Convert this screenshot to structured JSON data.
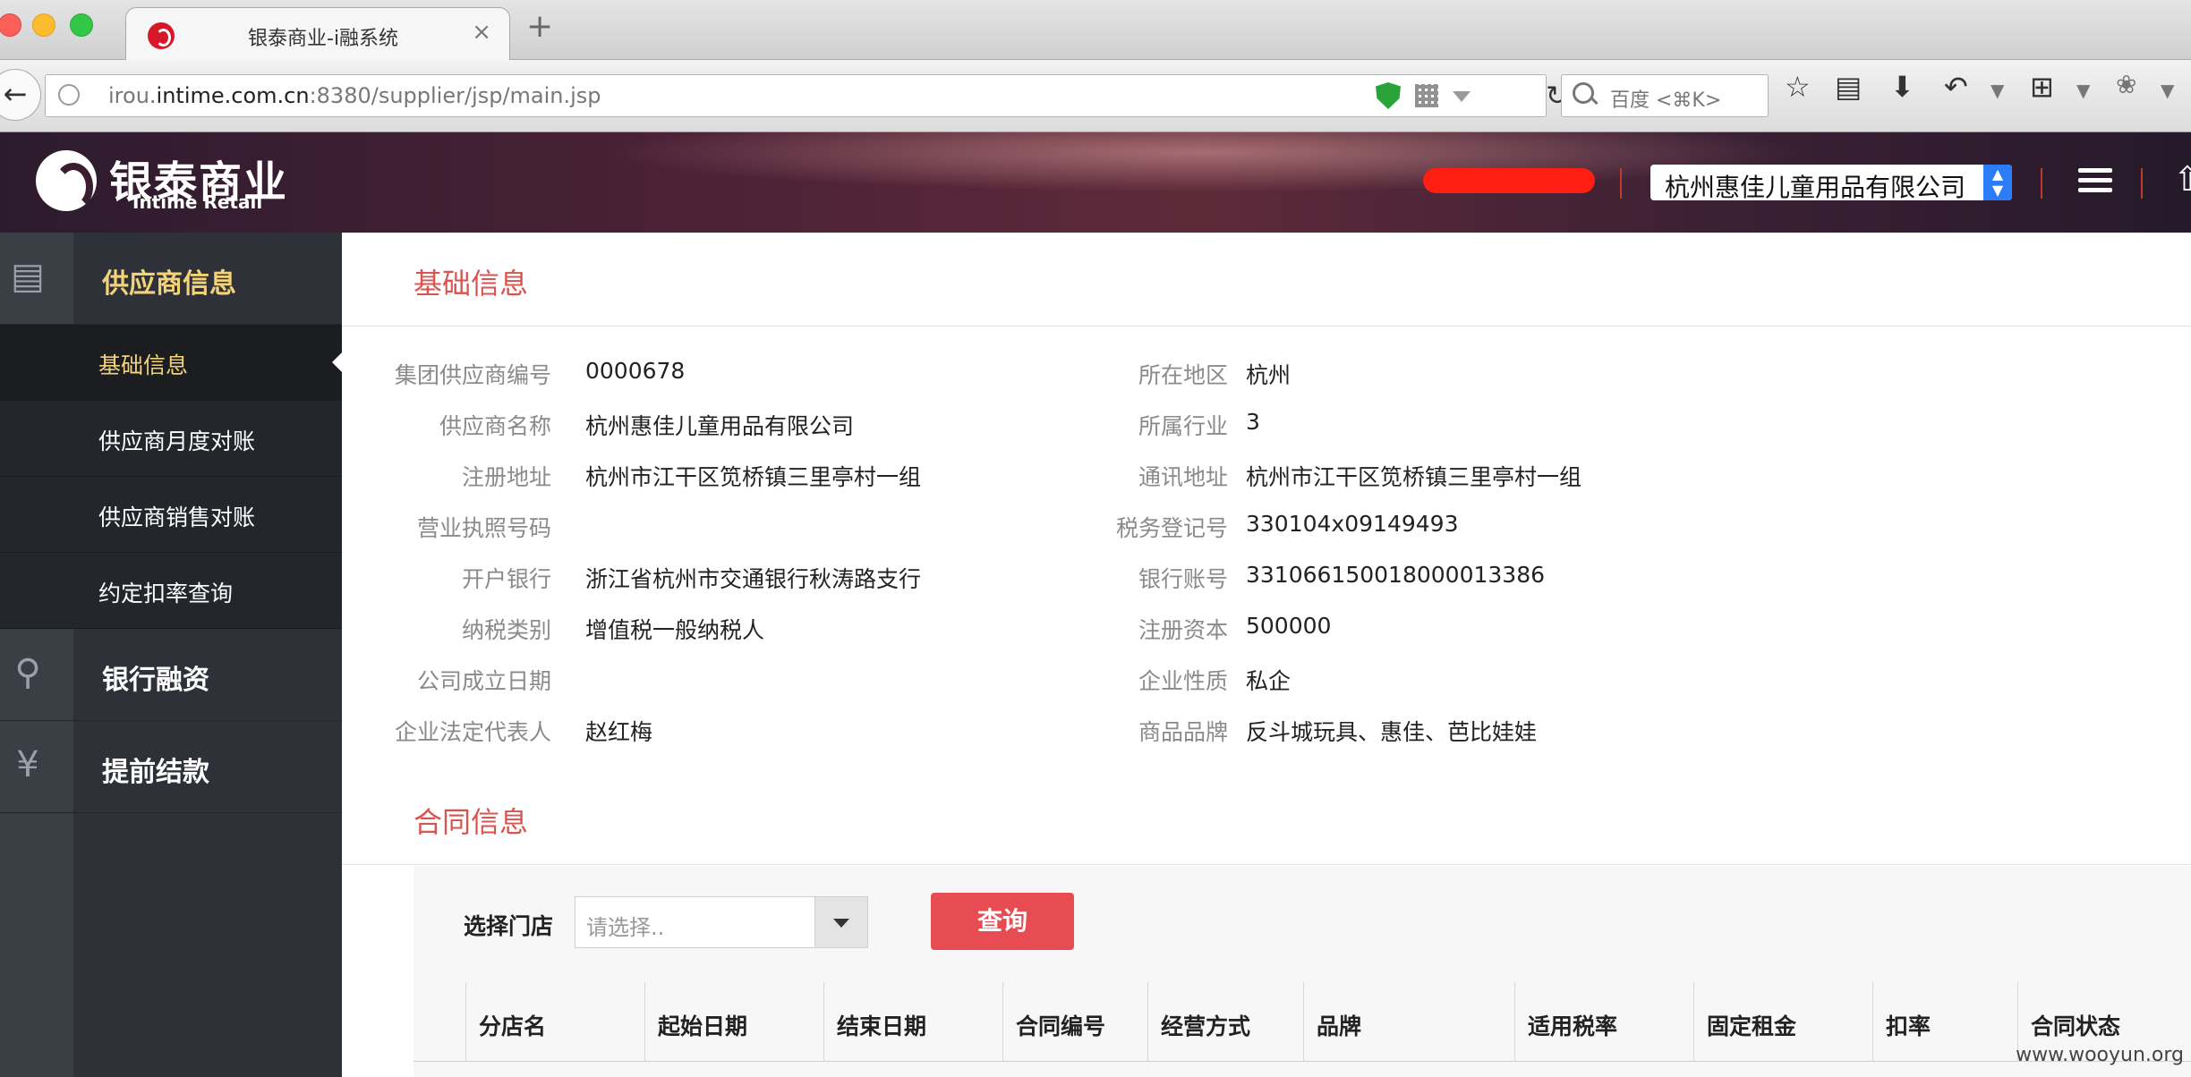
{
  "browser": {
    "tab_title": "银泰商业-i融系统",
    "tab_close": "×",
    "new_tab": "+",
    "url_prefix": "irou.",
    "url_domain": "intime.com.cn",
    "url_path": ":8380/supplier/jsp/main.jsp",
    "search_placeholder": "百度 <⌘K>"
  },
  "header": {
    "logo_cn": "银泰商业",
    "logo_en": "Intime Retail",
    "company": "杭州惠佳儿童用品有限公司"
  },
  "sidebar": {
    "groups": [
      {
        "label": "供应商信息",
        "icon": "list-icon"
      },
      {
        "label": "银行融资",
        "icon": "bag-search-icon"
      },
      {
        "label": "提前结款",
        "icon": "yen-icon"
      }
    ],
    "sub_items": [
      {
        "label": "基础信息"
      },
      {
        "label": "供应商月度对账"
      },
      {
        "label": "供应商销售对账"
      },
      {
        "label": "约定扣率查询"
      }
    ]
  },
  "basic_info": {
    "title": "基础信息",
    "left": [
      {
        "label": "集团供应商编号",
        "value": "0000678"
      },
      {
        "label": "供应商名称",
        "value": "杭州惠佳儿童用品有限公司"
      },
      {
        "label": "注册地址",
        "value": "杭州市江干区笕桥镇三里亭村一组"
      },
      {
        "label": "营业执照号码",
        "value": ""
      },
      {
        "label": "开户银行",
        "value": "浙江省杭州市交通银行秋涛路支行"
      },
      {
        "label": "纳税类别",
        "value": "增值税一般纳税人"
      },
      {
        "label": "公司成立日期",
        "value": ""
      },
      {
        "label": "企业法定代表人",
        "value": "赵红梅"
      }
    ],
    "right": [
      {
        "label": "所在地区",
        "value": "杭州"
      },
      {
        "label": "所属行业",
        "value": "3"
      },
      {
        "label": "通讯地址",
        "value": "杭州市江干区笕桥镇三里亭村一组"
      },
      {
        "label": "税务登记号",
        "value": "330104x09149493"
      },
      {
        "label": "银行账号",
        "value": "331066150018000013386"
      },
      {
        "label": "注册资本",
        "value": "500000"
      },
      {
        "label": "企业性质",
        "value": "私企"
      },
      {
        "label": "商品品牌",
        "value": "反斗城玩具、惠佳、芭比娃娃"
      }
    ]
  },
  "contract": {
    "title": "合同信息",
    "store_label": "选择门店",
    "store_placeholder": "请选择..",
    "query_label": "查询",
    "columns": [
      "分店名",
      "起始日期",
      "结束日期",
      "合同编号",
      "经营方式",
      "品牌",
      "适用税率",
      "固定租金",
      "扣率",
      "合同状态"
    ]
  },
  "watermark": "www.wooyun.org"
}
